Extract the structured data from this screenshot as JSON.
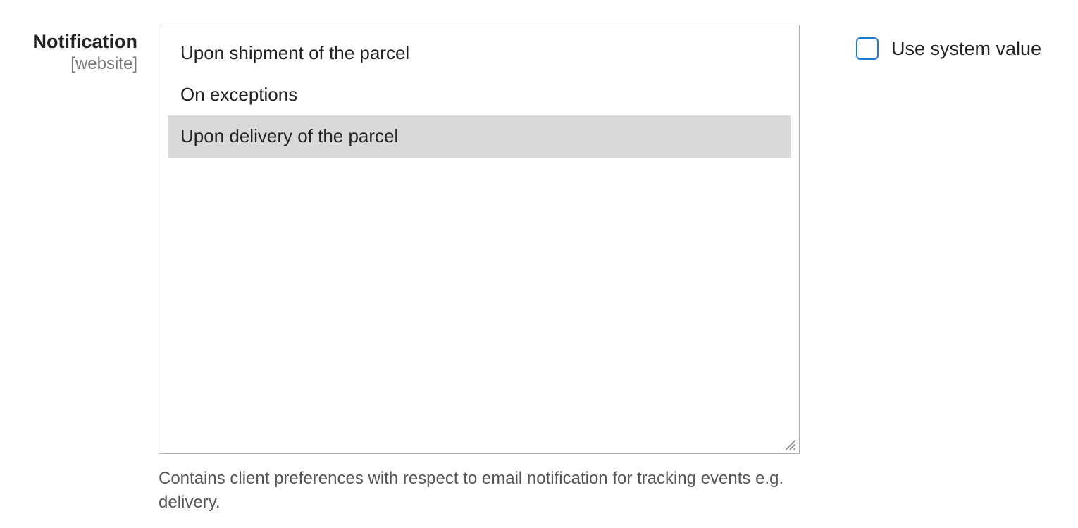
{
  "field": {
    "label": "Notification",
    "scope": "[website]",
    "options": [
      {
        "label": "Upon shipment of the parcel",
        "selected": false
      },
      {
        "label": "On exceptions",
        "selected": false
      },
      {
        "label": "Upon delivery of the parcel",
        "selected": true
      }
    ],
    "help": "Contains client preferences with respect to email notification for tracking events e.g. delivery."
  },
  "system_value": {
    "label": "Use system value",
    "checked": false
  }
}
